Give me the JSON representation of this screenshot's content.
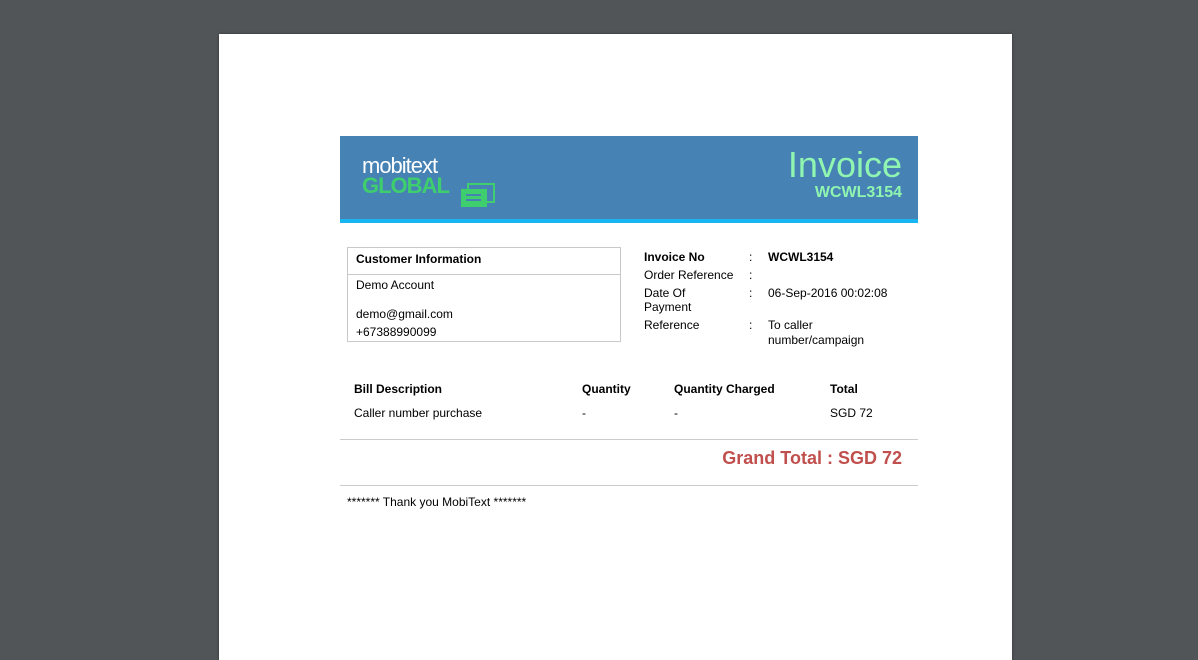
{
  "logo": {
    "line1": "mobitext",
    "line2": "GLOBAL"
  },
  "header": {
    "title": "Invoice",
    "code": "WCWL3154"
  },
  "customer": {
    "heading": "Customer Information",
    "name": "Demo Account",
    "email": "demo@gmail.com",
    "phone": "+67388990099"
  },
  "invoice_info": [
    {
      "label": "Invoice No",
      "colon": ":",
      "value": "WCWL3154",
      "bold": true
    },
    {
      "label": "Order Reference",
      "colon": ":",
      "value": ""
    },
    {
      "label": "Date Of Payment",
      "colon": ":",
      "value": "06-Sep-2016 00:02:08"
    },
    {
      "label": "Reference",
      "colon": ":",
      "value": "To caller number/campaign"
    }
  ],
  "bill": {
    "headers": [
      "Bill Description",
      "Quantity",
      "Quantity Charged",
      "Total"
    ],
    "rows": [
      [
        "Caller number purchase",
        "-",
        "-",
        "SGD 72"
      ]
    ]
  },
  "grand_total": {
    "label": "Grand Total :",
    "value": "SGD 72"
  },
  "footer": {
    "thanks": "******* Thank you MobiText *******"
  },
  "colors": {
    "header_bg": "#4682b4",
    "header_accent": "#19b5f0",
    "title_green": "#8ff5b0",
    "grand_total_red": "#c0504d",
    "logo_green": "#3fce6e"
  }
}
